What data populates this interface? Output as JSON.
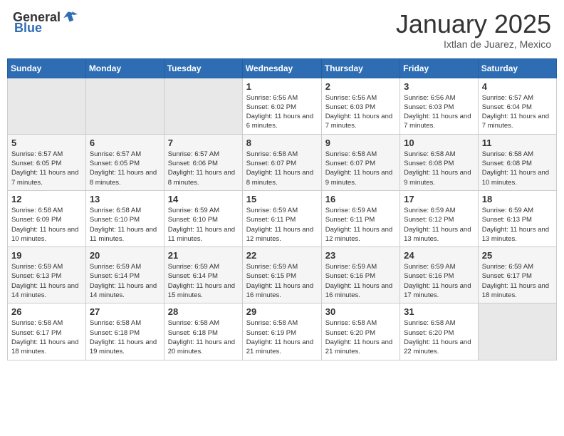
{
  "header": {
    "logo_general": "General",
    "logo_blue": "Blue",
    "month": "January 2025",
    "location": "Ixtlan de Juarez, Mexico"
  },
  "weekdays": [
    "Sunday",
    "Monday",
    "Tuesday",
    "Wednesday",
    "Thursday",
    "Friday",
    "Saturday"
  ],
  "weeks": [
    [
      {
        "day": "",
        "info": ""
      },
      {
        "day": "",
        "info": ""
      },
      {
        "day": "",
        "info": ""
      },
      {
        "day": "1",
        "info": "Sunrise: 6:56 AM\nSunset: 6:02 PM\nDaylight: 11 hours and 6 minutes."
      },
      {
        "day": "2",
        "info": "Sunrise: 6:56 AM\nSunset: 6:03 PM\nDaylight: 11 hours and 7 minutes."
      },
      {
        "day": "3",
        "info": "Sunrise: 6:56 AM\nSunset: 6:03 PM\nDaylight: 11 hours and 7 minutes."
      },
      {
        "day": "4",
        "info": "Sunrise: 6:57 AM\nSunset: 6:04 PM\nDaylight: 11 hours and 7 minutes."
      }
    ],
    [
      {
        "day": "5",
        "info": "Sunrise: 6:57 AM\nSunset: 6:05 PM\nDaylight: 11 hours and 7 minutes."
      },
      {
        "day": "6",
        "info": "Sunrise: 6:57 AM\nSunset: 6:05 PM\nDaylight: 11 hours and 8 minutes."
      },
      {
        "day": "7",
        "info": "Sunrise: 6:57 AM\nSunset: 6:06 PM\nDaylight: 11 hours and 8 minutes."
      },
      {
        "day": "8",
        "info": "Sunrise: 6:58 AM\nSunset: 6:07 PM\nDaylight: 11 hours and 8 minutes."
      },
      {
        "day": "9",
        "info": "Sunrise: 6:58 AM\nSunset: 6:07 PM\nDaylight: 11 hours and 9 minutes."
      },
      {
        "day": "10",
        "info": "Sunrise: 6:58 AM\nSunset: 6:08 PM\nDaylight: 11 hours and 9 minutes."
      },
      {
        "day": "11",
        "info": "Sunrise: 6:58 AM\nSunset: 6:08 PM\nDaylight: 11 hours and 10 minutes."
      }
    ],
    [
      {
        "day": "12",
        "info": "Sunrise: 6:58 AM\nSunset: 6:09 PM\nDaylight: 11 hours and 10 minutes."
      },
      {
        "day": "13",
        "info": "Sunrise: 6:58 AM\nSunset: 6:10 PM\nDaylight: 11 hours and 11 minutes."
      },
      {
        "day": "14",
        "info": "Sunrise: 6:59 AM\nSunset: 6:10 PM\nDaylight: 11 hours and 11 minutes."
      },
      {
        "day": "15",
        "info": "Sunrise: 6:59 AM\nSunset: 6:11 PM\nDaylight: 11 hours and 12 minutes."
      },
      {
        "day": "16",
        "info": "Sunrise: 6:59 AM\nSunset: 6:11 PM\nDaylight: 11 hours and 12 minutes."
      },
      {
        "day": "17",
        "info": "Sunrise: 6:59 AM\nSunset: 6:12 PM\nDaylight: 11 hours and 13 minutes."
      },
      {
        "day": "18",
        "info": "Sunrise: 6:59 AM\nSunset: 6:13 PM\nDaylight: 11 hours and 13 minutes."
      }
    ],
    [
      {
        "day": "19",
        "info": "Sunrise: 6:59 AM\nSunset: 6:13 PM\nDaylight: 11 hours and 14 minutes."
      },
      {
        "day": "20",
        "info": "Sunrise: 6:59 AM\nSunset: 6:14 PM\nDaylight: 11 hours and 14 minutes."
      },
      {
        "day": "21",
        "info": "Sunrise: 6:59 AM\nSunset: 6:14 PM\nDaylight: 11 hours and 15 minutes."
      },
      {
        "day": "22",
        "info": "Sunrise: 6:59 AM\nSunset: 6:15 PM\nDaylight: 11 hours and 16 minutes."
      },
      {
        "day": "23",
        "info": "Sunrise: 6:59 AM\nSunset: 6:16 PM\nDaylight: 11 hours and 16 minutes."
      },
      {
        "day": "24",
        "info": "Sunrise: 6:59 AM\nSunset: 6:16 PM\nDaylight: 11 hours and 17 minutes."
      },
      {
        "day": "25",
        "info": "Sunrise: 6:59 AM\nSunset: 6:17 PM\nDaylight: 11 hours and 18 minutes."
      }
    ],
    [
      {
        "day": "26",
        "info": "Sunrise: 6:58 AM\nSunset: 6:17 PM\nDaylight: 11 hours and 18 minutes."
      },
      {
        "day": "27",
        "info": "Sunrise: 6:58 AM\nSunset: 6:18 PM\nDaylight: 11 hours and 19 minutes."
      },
      {
        "day": "28",
        "info": "Sunrise: 6:58 AM\nSunset: 6:18 PM\nDaylight: 11 hours and 20 minutes."
      },
      {
        "day": "29",
        "info": "Sunrise: 6:58 AM\nSunset: 6:19 PM\nDaylight: 11 hours and 21 minutes."
      },
      {
        "day": "30",
        "info": "Sunrise: 6:58 AM\nSunset: 6:20 PM\nDaylight: 11 hours and 21 minutes."
      },
      {
        "day": "31",
        "info": "Sunrise: 6:58 AM\nSunset: 6:20 PM\nDaylight: 11 hours and 22 minutes."
      },
      {
        "day": "",
        "info": ""
      }
    ]
  ]
}
